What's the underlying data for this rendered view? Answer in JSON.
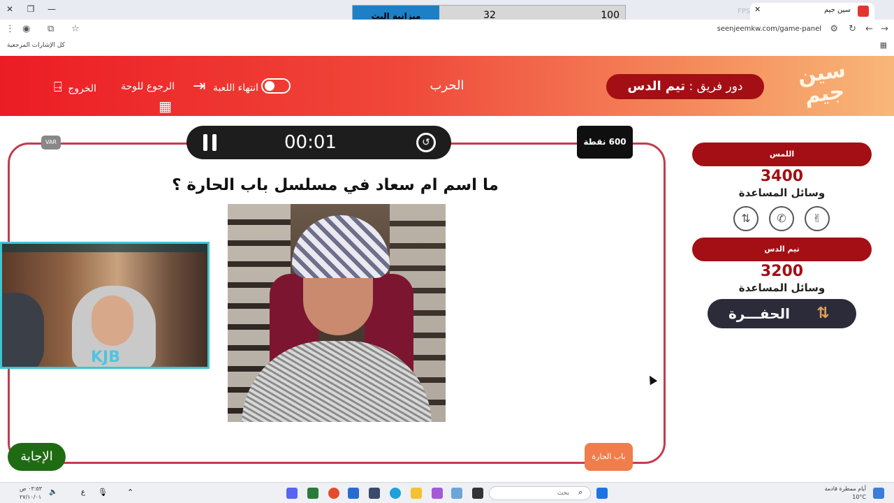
{
  "browser": {
    "tab_title": "سين جيم",
    "url": "seenjeemkw.com/game-panel",
    "bookmarks_label": "كل الإشارات المرجعية",
    "fps_text": "FPS: N/A"
  },
  "overlay": {
    "label": "ميزانية البث",
    "value_a": "32",
    "value_b": "100"
  },
  "header": {
    "logo_text": "سين جيم",
    "turn_prefix": "دور فريق :",
    "turn_team": "تيم الدس",
    "category": "الحرب",
    "end_game": "انتهاء اللعبة",
    "back_to_board": "الرجوع للوحة",
    "exit": "الخروج"
  },
  "game": {
    "timer": "00:01",
    "points": "600 نقطة",
    "var_label": "VAR",
    "question": "ما اسم ام سعاد في مسلسل باب الحارة ؟",
    "answer_button": "الإجابة",
    "hint_button": "باب الحارة"
  },
  "webcam": {
    "watermark": "KJB"
  },
  "teams": [
    {
      "name": "اللمس",
      "score": "3400",
      "aids_label": "وسائل المساعدة"
    },
    {
      "name": "تيم الدس",
      "score": "3200",
      "aids_label": "وسائل المساعدة"
    }
  ],
  "aids": [
    "swap-icon",
    "phone-icon",
    "victory-hand-icon"
  ],
  "pit_label": "الحفـــرة",
  "taskbar": {
    "search_placeholder": "بحث",
    "weather_line1": "أيام ممطرة قادمة",
    "weather_line2": "10°C",
    "time": "٠٣:٥٣ ص",
    "date": "٢٧/١٠/٠١",
    "lang": "ع"
  },
  "colors": {
    "accent_red": "#a30f14",
    "frame_red": "#c43b4d",
    "answer_green": "#1f6b13",
    "hint_orange": "#f07d4b"
  }
}
